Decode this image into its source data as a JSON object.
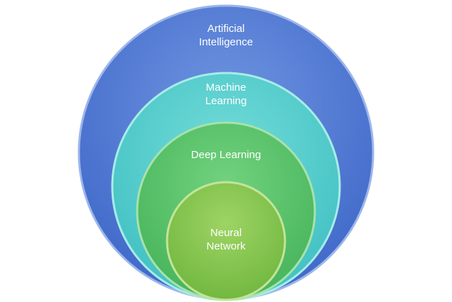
{
  "diagram": {
    "circles": [
      {
        "id": "artificial-intelligence",
        "lines": [
          "Artificial",
          "Intelligence"
        ],
        "fill_light": "#6f95e0",
        "fill_dark": "#3d66c8",
        "stroke": "#9db6ea"
      },
      {
        "id": "machine-learning",
        "lines": [
          "Machine",
          "Learning"
        ],
        "fill_light": "#72dcd8",
        "fill_dark": "#3fbfc2",
        "stroke": "#a8ece8"
      },
      {
        "id": "deep-learning",
        "lines": [
          "Deep Learning"
        ],
        "fill_light": "#72d27e",
        "fill_dark": "#45b35a",
        "stroke": "#a6e2ac"
      },
      {
        "id": "neural-network",
        "lines": [
          "Neural",
          "Network"
        ],
        "fill_light": "#9ed464",
        "fill_dark": "#6fb63e",
        "stroke": "#c2e49a"
      }
    ]
  }
}
